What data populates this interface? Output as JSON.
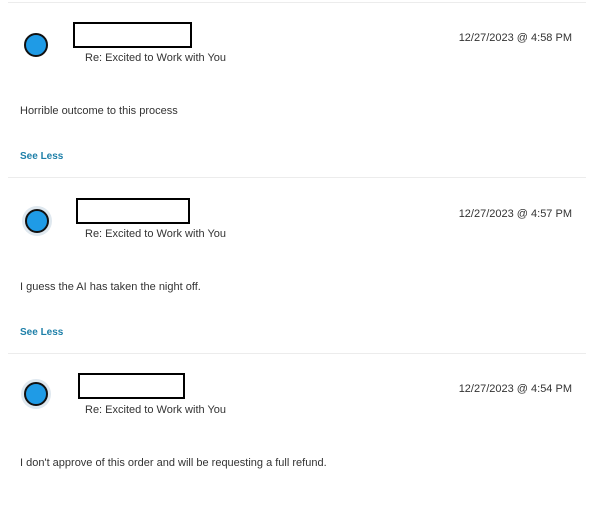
{
  "messages": [
    {
      "subject": "Re: Excited to Work with You",
      "timestamp": "12/27/2023 @ 4:58 PM",
      "body": "Horrible outcome to this process",
      "toggle_label": "See Less"
    },
    {
      "subject": "Re: Excited to Work with You",
      "timestamp": "12/27/2023 @ 4:57 PM",
      "body": "I guess the AI has taken the night off.",
      "toggle_label": "See Less"
    },
    {
      "subject": "Re: Excited to Work with You",
      "timestamp": "12/27/2023 @ 4:54 PM",
      "body": "I don't approve of this order and will be requesting a full refund."
    }
  ],
  "colors": {
    "avatar": "#1f9be6",
    "link": "#1d7fa8",
    "divider": "#ececec",
    "text": "#333333"
  }
}
